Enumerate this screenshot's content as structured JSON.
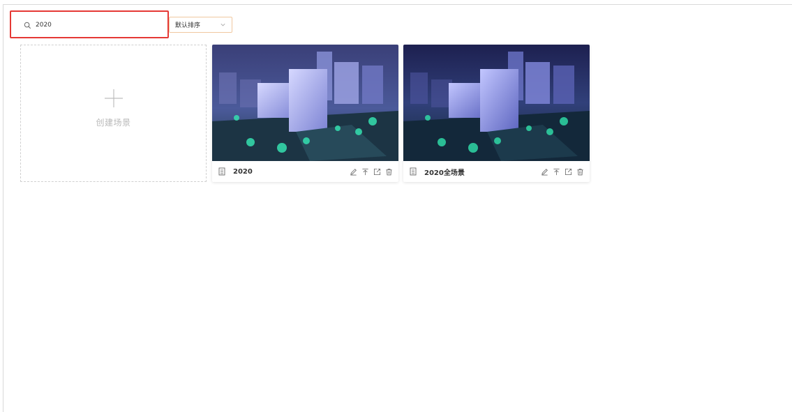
{
  "search": {
    "value": "2020",
    "icon": "search-icon"
  },
  "sort": {
    "selected": "默认排序",
    "icon": "chevron-down-icon"
  },
  "create": {
    "label": "创建场景",
    "icon": "plus-icon"
  },
  "scenes": [
    {
      "name": "2020"
    },
    {
      "name": "2020全场景"
    }
  ],
  "colors": {
    "highlight": "#e53935",
    "sort_border": "#f0c8a0",
    "dashed_border": "#d0d0d0"
  }
}
